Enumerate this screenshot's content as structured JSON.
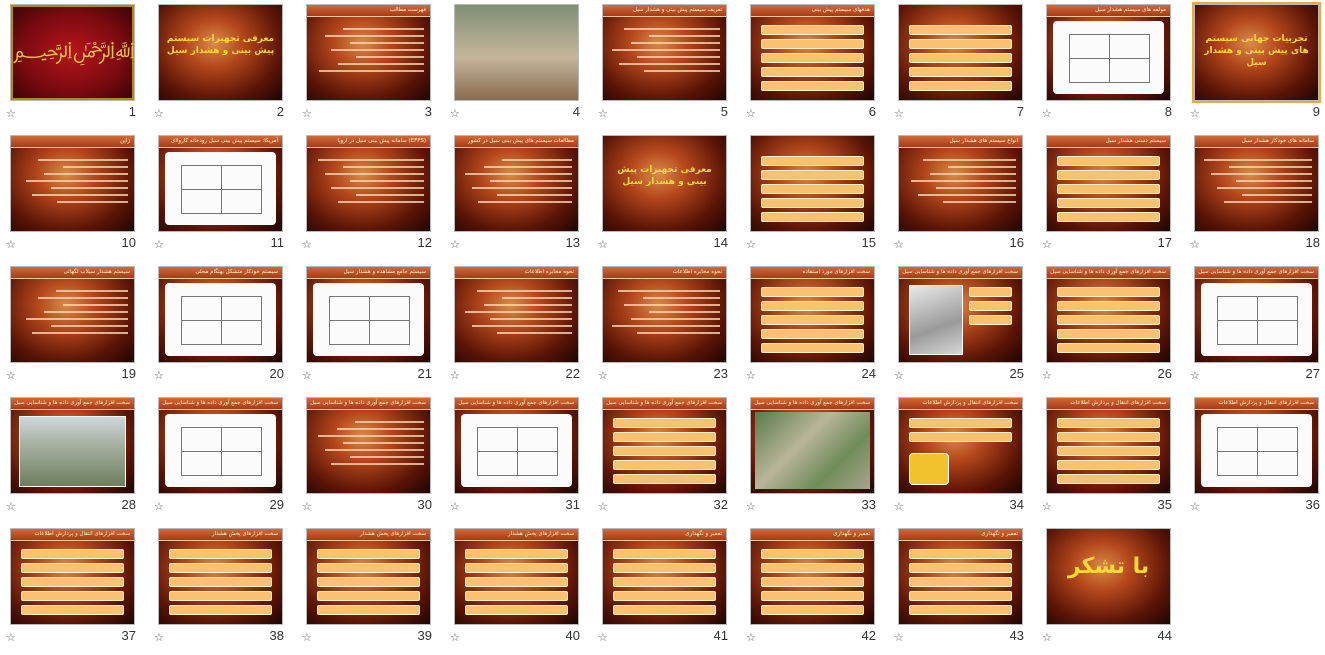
{
  "slides": [
    {
      "n": "1",
      "kind": "calligraphy",
      "title": "",
      "big": ""
    },
    {
      "n": "2",
      "kind": "title",
      "title": "",
      "big": "معرفی تجهیزات سیستم پیش بینی و هشدار سیل"
    },
    {
      "n": "3",
      "kind": "lines",
      "title": "فهرست مطالب",
      "big": ""
    },
    {
      "n": "4",
      "kind": "river",
      "title": "",
      "big": ""
    },
    {
      "n": "5",
      "kind": "lines",
      "title": "تعریف سیستم پیش بینی و هشدار سیل",
      "big": ""
    },
    {
      "n": "6",
      "kind": "boxes",
      "title": "هدفهای سیستم پیش بینی",
      "big": ""
    },
    {
      "n": "7",
      "kind": "boxes",
      "title": "",
      "big": ""
    },
    {
      "n": "8",
      "kind": "white",
      "title": "مولفه های سیستم هشدار سیل",
      "big": ""
    },
    {
      "n": "9",
      "kind": "title",
      "title": "",
      "big": "تجربیات جهانی سیستم های پیش بینی و هشدار سیل"
    },
    {
      "n": "10",
      "kind": "lines",
      "title": "ژاپن",
      "big": ""
    },
    {
      "n": "11",
      "kind": "white",
      "title": "آمریکا: سیستم پیش بینی سیل رودخانه کارولای",
      "big": ""
    },
    {
      "n": "12",
      "kind": "lines",
      "title": "سامانه پیش بینی سیل در اروپا (EFFS)",
      "big": ""
    },
    {
      "n": "13",
      "kind": "lines",
      "title": "مطالعات سیستم های پیش بینی سیل در کشور",
      "big": ""
    },
    {
      "n": "14",
      "kind": "title",
      "title": "",
      "big": "معرفی تجهیزات پیش بینی و هشدار سیل"
    },
    {
      "n": "15",
      "kind": "boxes",
      "title": "",
      "big": ""
    },
    {
      "n": "16",
      "kind": "lines",
      "title": "انواع سیستم های هشدار سیل",
      "big": ""
    },
    {
      "n": "17",
      "kind": "boxes",
      "title": "سیستم دستی هشدار سیل",
      "big": ""
    },
    {
      "n": "18",
      "kind": "lines",
      "title": "سامانه های خودکار هشدار سیل",
      "big": ""
    },
    {
      "n": "19",
      "kind": "lines",
      "title": "سیستم هشدار سیلاب لگهائی",
      "big": ""
    },
    {
      "n": "20",
      "kind": "white",
      "title": "سیستم خودکار متشکل بهنگام محلی",
      "big": ""
    },
    {
      "n": "21",
      "kind": "white",
      "title": "سیستم جامع مشاهده و هشدار سیل",
      "big": ""
    },
    {
      "n": "22",
      "kind": "lines",
      "title": "نحوه مخابره اطلاعات",
      "big": ""
    },
    {
      "n": "23",
      "kind": "lines",
      "title": "نحوه مخابره اطلاعات",
      "big": ""
    },
    {
      "n": "24",
      "kind": "boxes",
      "title": "سخت افزارهای مورد استفاده",
      "big": ""
    },
    {
      "n": "25",
      "kind": "device",
      "title": "سخت افزارهای جمع آوری داده ها و شناسایی سیل",
      "big": ""
    },
    {
      "n": "26",
      "kind": "boxes",
      "title": "سخت افزارهای جمع آوری داده ها و شناسایی سیل",
      "big": ""
    },
    {
      "n": "27",
      "kind": "white",
      "title": "سخت افزارهای جمع آوری داده ها و شناسایی سیل",
      "big": ""
    },
    {
      "n": "28",
      "kind": "dam",
      "title": "سخت افزارهای جمع آوری داده ها و شناسایی سیل",
      "big": ""
    },
    {
      "n": "29",
      "kind": "white",
      "title": "سخت افزارهای جمع آوری داده ها و شناسایی سیل",
      "big": ""
    },
    {
      "n": "30",
      "kind": "lines",
      "title": "سخت افزارهای جمع آوری داده ها و شناسایی سیل",
      "big": ""
    },
    {
      "n": "31",
      "kind": "white",
      "title": "سخت افزارهای جمع آوری داده ها و شناسایی سیل",
      "big": ""
    },
    {
      "n": "32",
      "kind": "boxes",
      "title": "سخت افزارهای جمع آوری داده ها و شناسایی سیل",
      "big": ""
    },
    {
      "n": "33",
      "kind": "map",
      "title": "سخت افزارهای جمع آوری داده ها و شناسایی سیل",
      "big": ""
    },
    {
      "n": "34",
      "kind": "radio",
      "title": "سخت افزارهای انتقال و پردازش اطلاعات",
      "big": ""
    },
    {
      "n": "35",
      "kind": "boxes",
      "title": "سخت افزارهای انتقال و پردازش اطلاعات",
      "big": ""
    },
    {
      "n": "36",
      "kind": "white",
      "title": "سخت افزارهای انتقال و پردازش اطلاعات",
      "big": ""
    },
    {
      "n": "37",
      "kind": "boxes",
      "title": "سخت افزارهای انتقال و پردازش اطلاعات",
      "big": ""
    },
    {
      "n": "38",
      "kind": "boxes",
      "title": "سخت افزارهای پخش هشدار",
      "big": ""
    },
    {
      "n": "39",
      "kind": "boxes",
      "title": "سخت افزارهای پخش هشدار",
      "big": ""
    },
    {
      "n": "40",
      "kind": "boxes",
      "title": "سخت افزارهای پخش هشدار",
      "big": ""
    },
    {
      "n": "41",
      "kind": "boxes",
      "title": "تعمیر و نگهداری",
      "big": ""
    },
    {
      "n": "42",
      "kind": "boxes",
      "title": "تعمیر و نگهداری",
      "big": ""
    },
    {
      "n": "43",
      "kind": "boxes",
      "title": "تعمیر و نگهداری",
      "big": ""
    },
    {
      "n": "44",
      "kind": "title",
      "title": "",
      "big": "با تشکر"
    }
  ],
  "star_icon": "☆",
  "selected_slide": "9"
}
